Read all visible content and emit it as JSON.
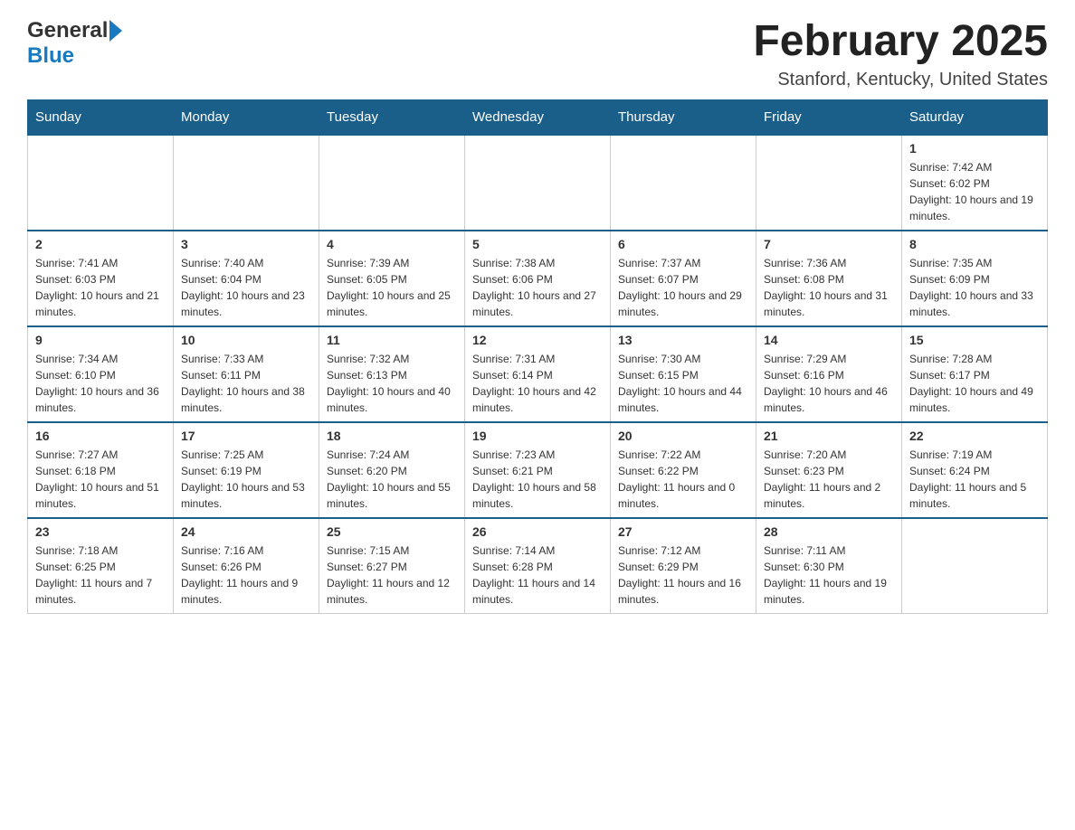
{
  "header": {
    "logo_general": "General",
    "logo_blue": "Blue",
    "month_title": "February 2025",
    "location": "Stanford, Kentucky, United States"
  },
  "days_of_week": [
    "Sunday",
    "Monday",
    "Tuesday",
    "Wednesday",
    "Thursday",
    "Friday",
    "Saturday"
  ],
  "weeks": [
    [
      {
        "day": "",
        "sunrise": "",
        "sunset": "",
        "daylight": ""
      },
      {
        "day": "",
        "sunrise": "",
        "sunset": "",
        "daylight": ""
      },
      {
        "day": "",
        "sunrise": "",
        "sunset": "",
        "daylight": ""
      },
      {
        "day": "",
        "sunrise": "",
        "sunset": "",
        "daylight": ""
      },
      {
        "day": "",
        "sunrise": "",
        "sunset": "",
        "daylight": ""
      },
      {
        "day": "",
        "sunrise": "",
        "sunset": "",
        "daylight": ""
      },
      {
        "day": "1",
        "sunrise": "Sunrise: 7:42 AM",
        "sunset": "Sunset: 6:02 PM",
        "daylight": "Daylight: 10 hours and 19 minutes."
      }
    ],
    [
      {
        "day": "2",
        "sunrise": "Sunrise: 7:41 AM",
        "sunset": "Sunset: 6:03 PM",
        "daylight": "Daylight: 10 hours and 21 minutes."
      },
      {
        "day": "3",
        "sunrise": "Sunrise: 7:40 AM",
        "sunset": "Sunset: 6:04 PM",
        "daylight": "Daylight: 10 hours and 23 minutes."
      },
      {
        "day": "4",
        "sunrise": "Sunrise: 7:39 AM",
        "sunset": "Sunset: 6:05 PM",
        "daylight": "Daylight: 10 hours and 25 minutes."
      },
      {
        "day": "5",
        "sunrise": "Sunrise: 7:38 AM",
        "sunset": "Sunset: 6:06 PM",
        "daylight": "Daylight: 10 hours and 27 minutes."
      },
      {
        "day": "6",
        "sunrise": "Sunrise: 7:37 AM",
        "sunset": "Sunset: 6:07 PM",
        "daylight": "Daylight: 10 hours and 29 minutes."
      },
      {
        "day": "7",
        "sunrise": "Sunrise: 7:36 AM",
        "sunset": "Sunset: 6:08 PM",
        "daylight": "Daylight: 10 hours and 31 minutes."
      },
      {
        "day": "8",
        "sunrise": "Sunrise: 7:35 AM",
        "sunset": "Sunset: 6:09 PM",
        "daylight": "Daylight: 10 hours and 33 minutes."
      }
    ],
    [
      {
        "day": "9",
        "sunrise": "Sunrise: 7:34 AM",
        "sunset": "Sunset: 6:10 PM",
        "daylight": "Daylight: 10 hours and 36 minutes."
      },
      {
        "day": "10",
        "sunrise": "Sunrise: 7:33 AM",
        "sunset": "Sunset: 6:11 PM",
        "daylight": "Daylight: 10 hours and 38 minutes."
      },
      {
        "day": "11",
        "sunrise": "Sunrise: 7:32 AM",
        "sunset": "Sunset: 6:13 PM",
        "daylight": "Daylight: 10 hours and 40 minutes."
      },
      {
        "day": "12",
        "sunrise": "Sunrise: 7:31 AM",
        "sunset": "Sunset: 6:14 PM",
        "daylight": "Daylight: 10 hours and 42 minutes."
      },
      {
        "day": "13",
        "sunrise": "Sunrise: 7:30 AM",
        "sunset": "Sunset: 6:15 PM",
        "daylight": "Daylight: 10 hours and 44 minutes."
      },
      {
        "day": "14",
        "sunrise": "Sunrise: 7:29 AM",
        "sunset": "Sunset: 6:16 PM",
        "daylight": "Daylight: 10 hours and 46 minutes."
      },
      {
        "day": "15",
        "sunrise": "Sunrise: 7:28 AM",
        "sunset": "Sunset: 6:17 PM",
        "daylight": "Daylight: 10 hours and 49 minutes."
      }
    ],
    [
      {
        "day": "16",
        "sunrise": "Sunrise: 7:27 AM",
        "sunset": "Sunset: 6:18 PM",
        "daylight": "Daylight: 10 hours and 51 minutes."
      },
      {
        "day": "17",
        "sunrise": "Sunrise: 7:25 AM",
        "sunset": "Sunset: 6:19 PM",
        "daylight": "Daylight: 10 hours and 53 minutes."
      },
      {
        "day": "18",
        "sunrise": "Sunrise: 7:24 AM",
        "sunset": "Sunset: 6:20 PM",
        "daylight": "Daylight: 10 hours and 55 minutes."
      },
      {
        "day": "19",
        "sunrise": "Sunrise: 7:23 AM",
        "sunset": "Sunset: 6:21 PM",
        "daylight": "Daylight: 10 hours and 58 minutes."
      },
      {
        "day": "20",
        "sunrise": "Sunrise: 7:22 AM",
        "sunset": "Sunset: 6:22 PM",
        "daylight": "Daylight: 11 hours and 0 minutes."
      },
      {
        "day": "21",
        "sunrise": "Sunrise: 7:20 AM",
        "sunset": "Sunset: 6:23 PM",
        "daylight": "Daylight: 11 hours and 2 minutes."
      },
      {
        "day": "22",
        "sunrise": "Sunrise: 7:19 AM",
        "sunset": "Sunset: 6:24 PM",
        "daylight": "Daylight: 11 hours and 5 minutes."
      }
    ],
    [
      {
        "day": "23",
        "sunrise": "Sunrise: 7:18 AM",
        "sunset": "Sunset: 6:25 PM",
        "daylight": "Daylight: 11 hours and 7 minutes."
      },
      {
        "day": "24",
        "sunrise": "Sunrise: 7:16 AM",
        "sunset": "Sunset: 6:26 PM",
        "daylight": "Daylight: 11 hours and 9 minutes."
      },
      {
        "day": "25",
        "sunrise": "Sunrise: 7:15 AM",
        "sunset": "Sunset: 6:27 PM",
        "daylight": "Daylight: 11 hours and 12 minutes."
      },
      {
        "day": "26",
        "sunrise": "Sunrise: 7:14 AM",
        "sunset": "Sunset: 6:28 PM",
        "daylight": "Daylight: 11 hours and 14 minutes."
      },
      {
        "day": "27",
        "sunrise": "Sunrise: 7:12 AM",
        "sunset": "Sunset: 6:29 PM",
        "daylight": "Daylight: 11 hours and 16 minutes."
      },
      {
        "day": "28",
        "sunrise": "Sunrise: 7:11 AM",
        "sunset": "Sunset: 6:30 PM",
        "daylight": "Daylight: 11 hours and 19 minutes."
      },
      {
        "day": "",
        "sunrise": "",
        "sunset": "",
        "daylight": ""
      }
    ]
  ]
}
